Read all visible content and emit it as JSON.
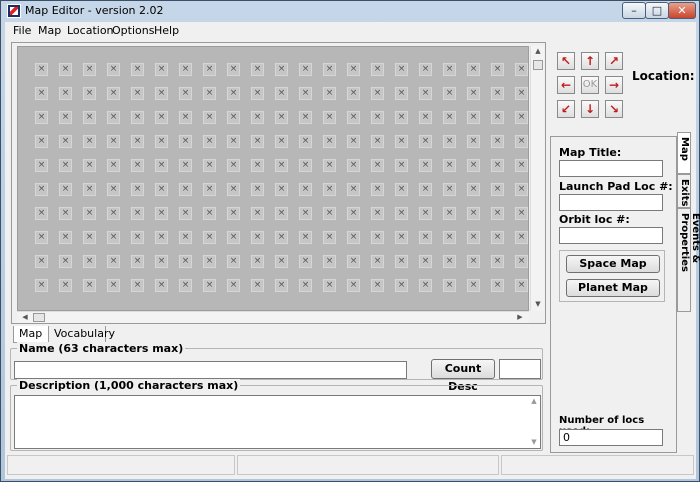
{
  "window": {
    "title": "Map Editor - version 2.02",
    "min_label": "–",
    "max_label": "□",
    "close_label": "✕"
  },
  "menu": [
    "File",
    "Map",
    "Location",
    "Options",
    "Help"
  ],
  "map_grid": {
    "cell_glyph": "×",
    "cols": 21,
    "rows": 10
  },
  "bottom_tabs": {
    "map": "Map",
    "vocabulary": "Vocabulary"
  },
  "name_group": {
    "label": "Name (63 characters max)",
    "value": "",
    "count_button": "Count Desc",
    "count_value": ""
  },
  "description_group": {
    "label": "Description (1,000 characters max)",
    "value": ""
  },
  "navigation": {
    "location_label": "Location:",
    "ok_label": "OK",
    "arrows": {
      "nw": "↖",
      "n": "↑",
      "ne": "↗",
      "w": "←",
      "e": "→",
      "sw": "↙",
      "s": "↓",
      "se": "↘"
    }
  },
  "side_tabs": [
    "Map",
    "Exits",
    "Events & Properties"
  ],
  "map_tab": {
    "title_label": "Map Title:",
    "title_value": "",
    "launch_pad_label": "Launch Pad Loc #:",
    "launch_pad_value": "",
    "orbit_label": "Orbit loc #:",
    "orbit_value": "",
    "space_map_button": "Space Map",
    "planet_map_button": "Planet Map",
    "locs_used_label": "Number of locs used:",
    "locs_used_value": "0"
  },
  "colors": {
    "arrow": "#c21a1a",
    "grid_bg": "#b7b7b7"
  }
}
